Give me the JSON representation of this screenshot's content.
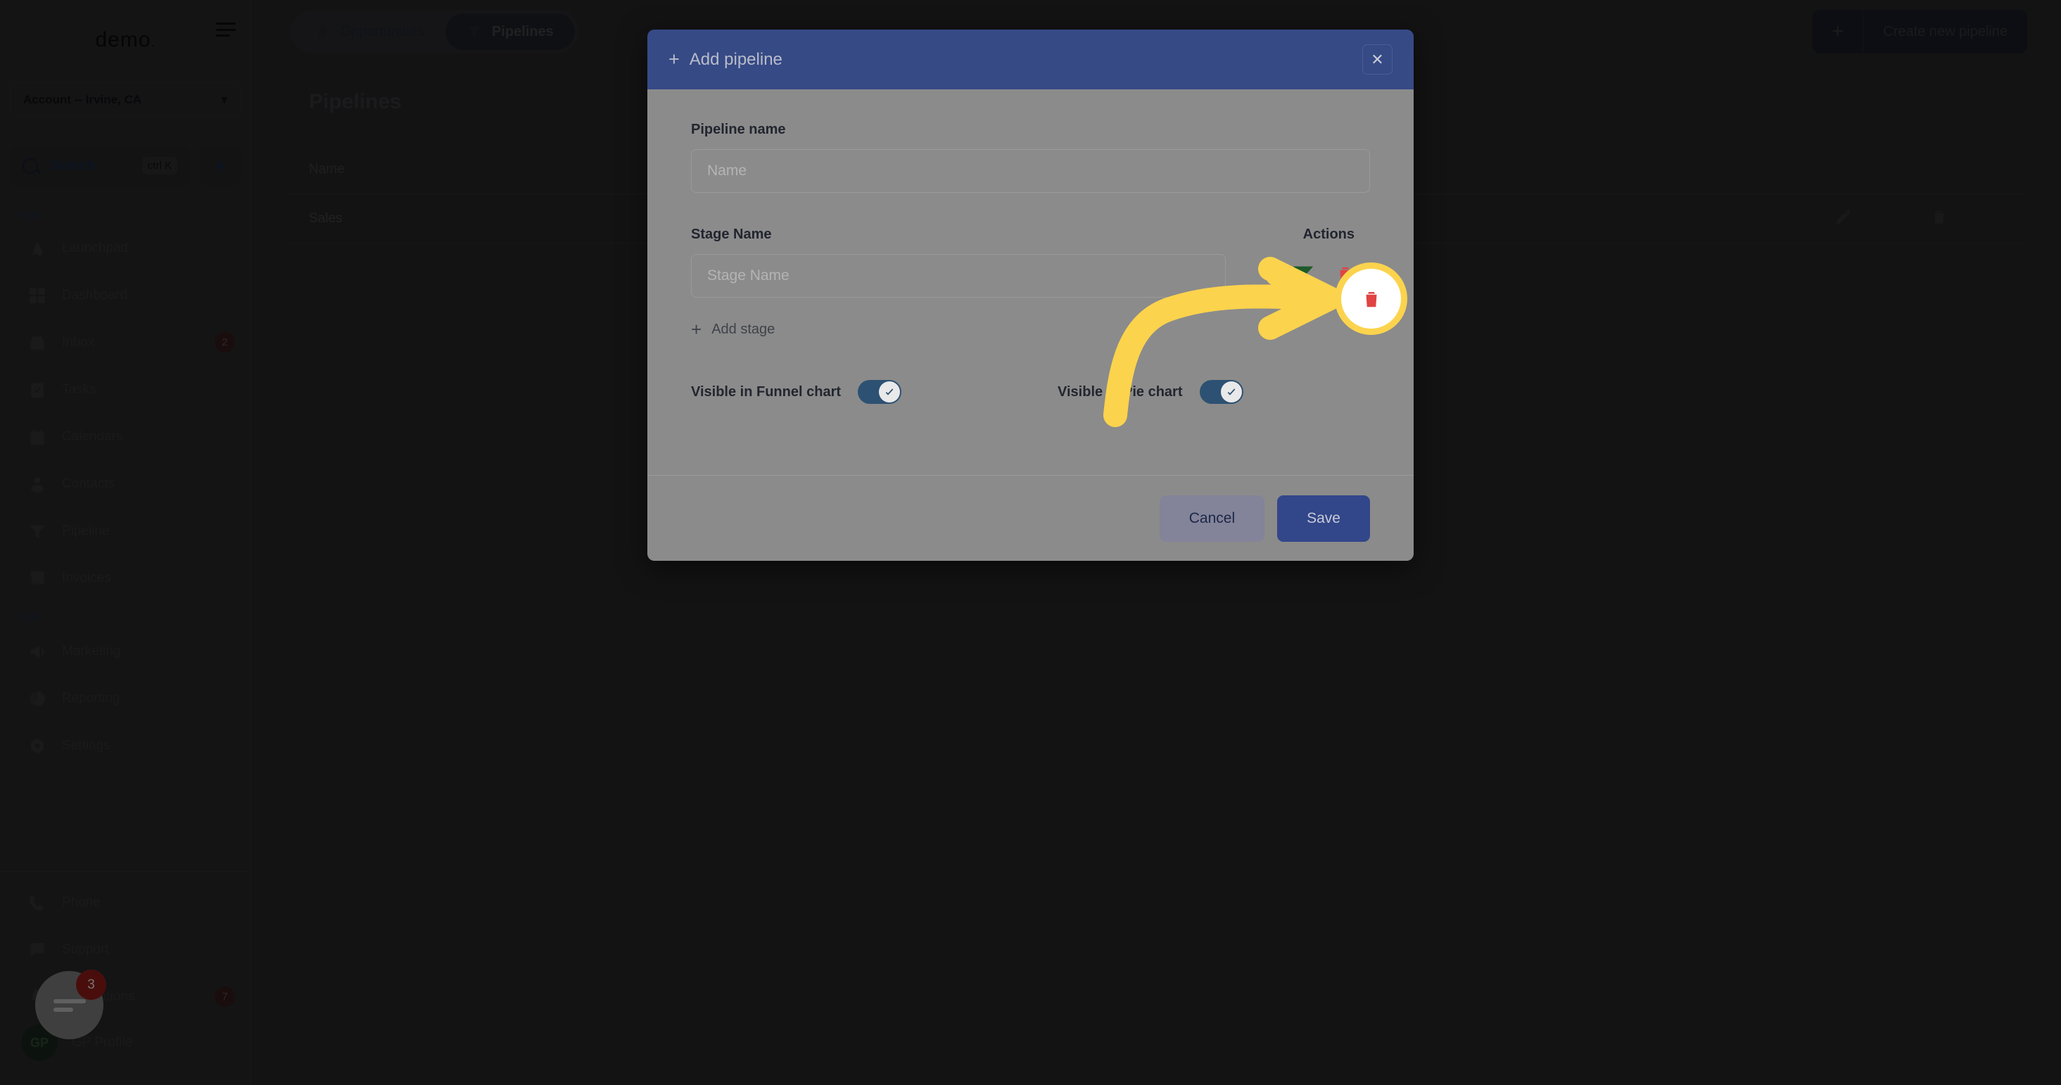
{
  "sidebar": {
    "brand": "demo",
    "account_selector": {
      "label": "Account -- Irvine, CA",
      "chevron": "chevron-down-icon"
    },
    "search": {
      "label": "Search",
      "shortcut": "ctrl K"
    },
    "sections": [
      {
        "title": "Apps",
        "items": [
          {
            "label": "Launchpad",
            "icon": "launchpad-icon",
            "badge": ""
          },
          {
            "label": "Dashboard",
            "icon": "dashboard-icon",
            "badge": ""
          },
          {
            "label": "Inbox",
            "icon": "inbox-icon",
            "badge": "2"
          },
          {
            "label": "Tasks",
            "icon": "tasks-icon",
            "badge": ""
          },
          {
            "label": "Calendars",
            "icon": "calendar-icon",
            "badge": ""
          },
          {
            "label": "Contacts",
            "icon": "contacts-icon",
            "badge": ""
          },
          {
            "label": "Pipeline",
            "icon": "funnel-icon",
            "badge": ""
          },
          {
            "label": "Invoices",
            "icon": "invoice-icon",
            "badge": ""
          }
        ]
      },
      {
        "title": "Tools",
        "items": [
          {
            "label": "Marketing",
            "icon": "megaphone-icon",
            "badge": ""
          },
          {
            "label": "Reporting",
            "icon": "pie-chart-icon",
            "badge": ""
          },
          {
            "label": "Settings",
            "icon": "gear-icon",
            "badge": ""
          }
        ]
      }
    ],
    "bottom_items": [
      {
        "label": "Phone",
        "icon": "phone-icon",
        "badge": ""
      },
      {
        "label": "Support",
        "icon": "chat-icon",
        "badge": ""
      },
      {
        "label": "Notifications",
        "icon": "bell-icon",
        "badge": "7"
      }
    ],
    "profile": {
      "initials": "GP",
      "label": "GP Profile"
    }
  },
  "topbar": {
    "segments": [
      {
        "label": "Opportunities",
        "icon": "dollar-icon",
        "active": false
      },
      {
        "label": "Pipelines",
        "icon": "funnel-icon",
        "active": true
      }
    ],
    "create_button": {
      "label": "Create new pipeline",
      "plus": "+"
    }
  },
  "main": {
    "page_title": "Pipelines",
    "table": {
      "columns": [
        "Name"
      ],
      "rows": [
        {
          "name": "Sales",
          "actions": [
            "edit-icon",
            "delete-icon"
          ]
        }
      ]
    }
  },
  "modal": {
    "title": "Add pipeline",
    "title_plus": "+",
    "close_label": "✕",
    "pipeline_name": {
      "label": "Pipeline name",
      "value": "",
      "placeholder": "Name"
    },
    "stage": {
      "name_label": "Stage Name",
      "actions_label": "Actions",
      "value": "",
      "placeholder": "Stage Name",
      "funnel_icon": "funnel-icon",
      "delete_icon": "delete-icon"
    },
    "add_stage_label": "Add stage",
    "add_stage_plus": "+",
    "toggles": [
      {
        "label": "Visible in Funnel chart",
        "on": true
      },
      {
        "label": "Visible in Pie chart",
        "on": true
      }
    ],
    "cancel_label": "Cancel",
    "save_label": "Save"
  },
  "annotation": {
    "highlight_target": "delete-stage-icon",
    "arrow_color": "#fcd34d",
    "circle_color": "#ffffff"
  },
  "chat_widget": {
    "badge": "3"
  },
  "colors": {
    "modal_header": "#364a86",
    "modal_body": "#8b8b8b",
    "save": "#32468a",
    "cancel": "#83839a",
    "delete": "#e04343",
    "annotation": "#fcd34d"
  }
}
